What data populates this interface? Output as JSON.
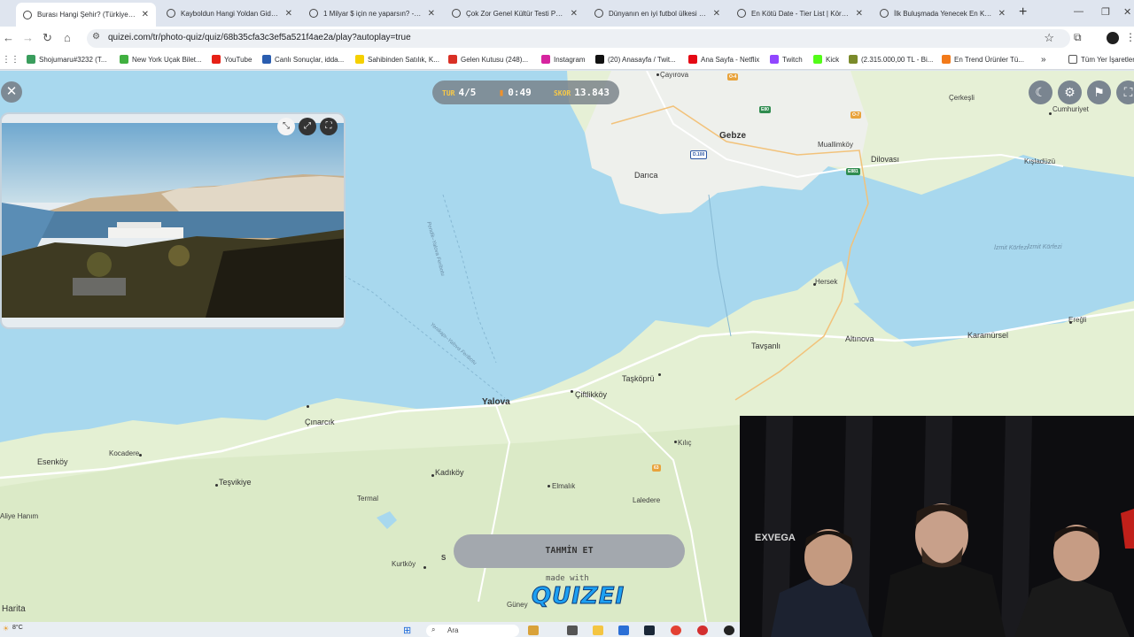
{
  "browser": {
    "tabs": [
      {
        "title": "Burası Hangi Şehir? (Türkiye) - Q",
        "active": true
      },
      {
        "title": "Kayboldun Hangi Yoldan Giders"
      },
      {
        "title": "1 Milyar $ için ne yaparsın? - Te"
      },
      {
        "title": "Çok Zor Genel Kültür Testi Parti"
      },
      {
        "title": "Dünyanın en iyi futbol ülkesi - C"
      },
      {
        "title": "En Kötü Date - Tier List | Kör Sö"
      },
      {
        "title": "İlk Buluşmada Yenecek En Kötü"
      }
    ],
    "new_tab_icon": "+",
    "url": "quizei.com/tr/photo-quiz/quiz/68b35cfa3c3ef5a521f4ae2a/play?autoplay=true",
    "bookmarks": [
      {
        "label": "Shojumaru#3232 (T...",
        "color": "#3a9d5d"
      },
      {
        "label": "New York Uçak Bilet...",
        "color": "#40b040"
      },
      {
        "label": "YouTube",
        "color": "#e62117"
      },
      {
        "label": "Canlı Sonuçlar, idda...",
        "color": "#2a5db0"
      },
      {
        "label": "Sahibinden Satılık, K...",
        "color": "#f5d000"
      },
      {
        "label": "Gelen Kutusu (248)...",
        "color": "#d93025"
      },
      {
        "label": "Instagram",
        "color": "#d6249f"
      },
      {
        "label": "(20) Anasayfa / Twit...",
        "color": "#111111"
      },
      {
        "label": "Ana Sayfa - Netflix",
        "color": "#e50914"
      },
      {
        "label": "Twitch",
        "color": "#9146ff"
      },
      {
        "label": "Kick",
        "color": "#53fc18"
      },
      {
        "label": "(2.315.000,00 TL - Bi...",
        "color": "#7a8a2a"
      },
      {
        "label": "En Trend Ürünler Tü...",
        "color": "#f27a1a"
      }
    ],
    "bookmarks_overflow": "»",
    "all_bookmarks": "Tüm Yer İşaretleri"
  },
  "hud": {
    "round_label": "TUR",
    "round_value": "4/5",
    "timer": "0:49",
    "score_label": "SKOR",
    "score_value": "13.843"
  },
  "map": {
    "places": [
      {
        "name": "Gebze",
        "cls": "big"
      },
      {
        "name": "Darıca",
        "cls": "mid"
      },
      {
        "name": "Dilovası",
        "cls": "mid"
      },
      {
        "name": "Çerkeşli"
      },
      {
        "name": "Cumhuriyet"
      },
      {
        "name": "Kışladüzü"
      },
      {
        "name": "Muallimköy"
      },
      {
        "name": "Hersek"
      },
      {
        "name": "Altınova",
        "cls": "mid"
      },
      {
        "name": "Tavşanlı",
        "cls": "mid"
      },
      {
        "name": "Karamürsel",
        "cls": "mid"
      },
      {
        "name": "Ereğli"
      },
      {
        "name": "Yalova",
        "cls": "big"
      },
      {
        "name": "Çiftlikköy",
        "cls": "mid"
      },
      {
        "name": "Taşköprü",
        "cls": "mid"
      },
      {
        "name": "Çınarcık",
        "cls": "mid"
      },
      {
        "name": "Esenköy",
        "cls": "mid"
      },
      {
        "name": "Kocadere"
      },
      {
        "name": "Teşvikiye",
        "cls": "mid"
      },
      {
        "name": "Kadıköy",
        "cls": "mid"
      },
      {
        "name": "Elmalık"
      },
      {
        "name": "Kılıç"
      },
      {
        "name": "Termal"
      },
      {
        "name": "Laledere"
      },
      {
        "name": "Aliye Hanım"
      },
      {
        "name": "Kurtköy"
      },
      {
        "name": "Güney"
      },
      {
        "name": "Çayırova"
      },
      {
        "name": "S"
      }
    ],
    "water_labels": [
      "İzmit Körfezi",
      "İzmit Körfezi",
      "Pendik–Yalova Feribotu",
      "Yenikapı–Yalova Feribotu"
    ],
    "shields": [
      "O-4",
      "O-7",
      "E80",
      "D.100",
      "E881",
      "63"
    ],
    "attribution": "Harita"
  },
  "photo": {
    "icons": [
      "collapse-icon",
      "expand-icon",
      "fullscreen-icon"
    ]
  },
  "guess_button": "TAHMİN ET",
  "branding": {
    "made_with": "made with",
    "logo": "QUIZEI"
  },
  "webcam": {
    "overlay_text": "EXVEGA"
  },
  "taskbar": {
    "weather": "8°C",
    "search": "Ara"
  },
  "colors": {
    "water": "#a8d8ee",
    "land": "#e4f0d3",
    "accent": "#1da0f2",
    "hud_label": "#f7c948"
  }
}
